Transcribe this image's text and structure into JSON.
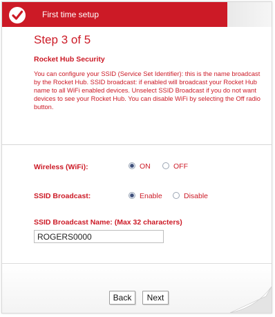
{
  "header": {
    "title": "First time setup",
    "logo_icon": "checkmark-icon"
  },
  "step": {
    "title": "Step 3 of 5"
  },
  "section": {
    "title": "Rocket Hub Security",
    "description": "You can configure your SSID (Service Set Identifier): this is the name broadcast by the Rocket Hub. SSID broadcast: if enabled will broadcast your Rocket Hub name to all WiFi enabled devices. Unselect SSID Broadcast if you do not want devices to see your Rocket Hub. You can disable WiFi by selecting the Off radio button."
  },
  "wireless": {
    "label": "Wireless (WiFi):",
    "options": [
      "ON",
      "OFF"
    ],
    "selected": "ON"
  },
  "ssid_broadcast": {
    "label": "SSID Broadcast:",
    "options": [
      "Enable",
      "Disable"
    ],
    "selected": "Enable"
  },
  "ssid_name": {
    "label": "SSID Broadcast Name: (Max 32 characters)",
    "value": "ROGERS0000"
  },
  "buttons": {
    "back": "Back",
    "next": "Next"
  },
  "colors": {
    "accent": "#cc1a26",
    "text_red": "#cc1a26",
    "radio_selected": "#3f4f79"
  }
}
